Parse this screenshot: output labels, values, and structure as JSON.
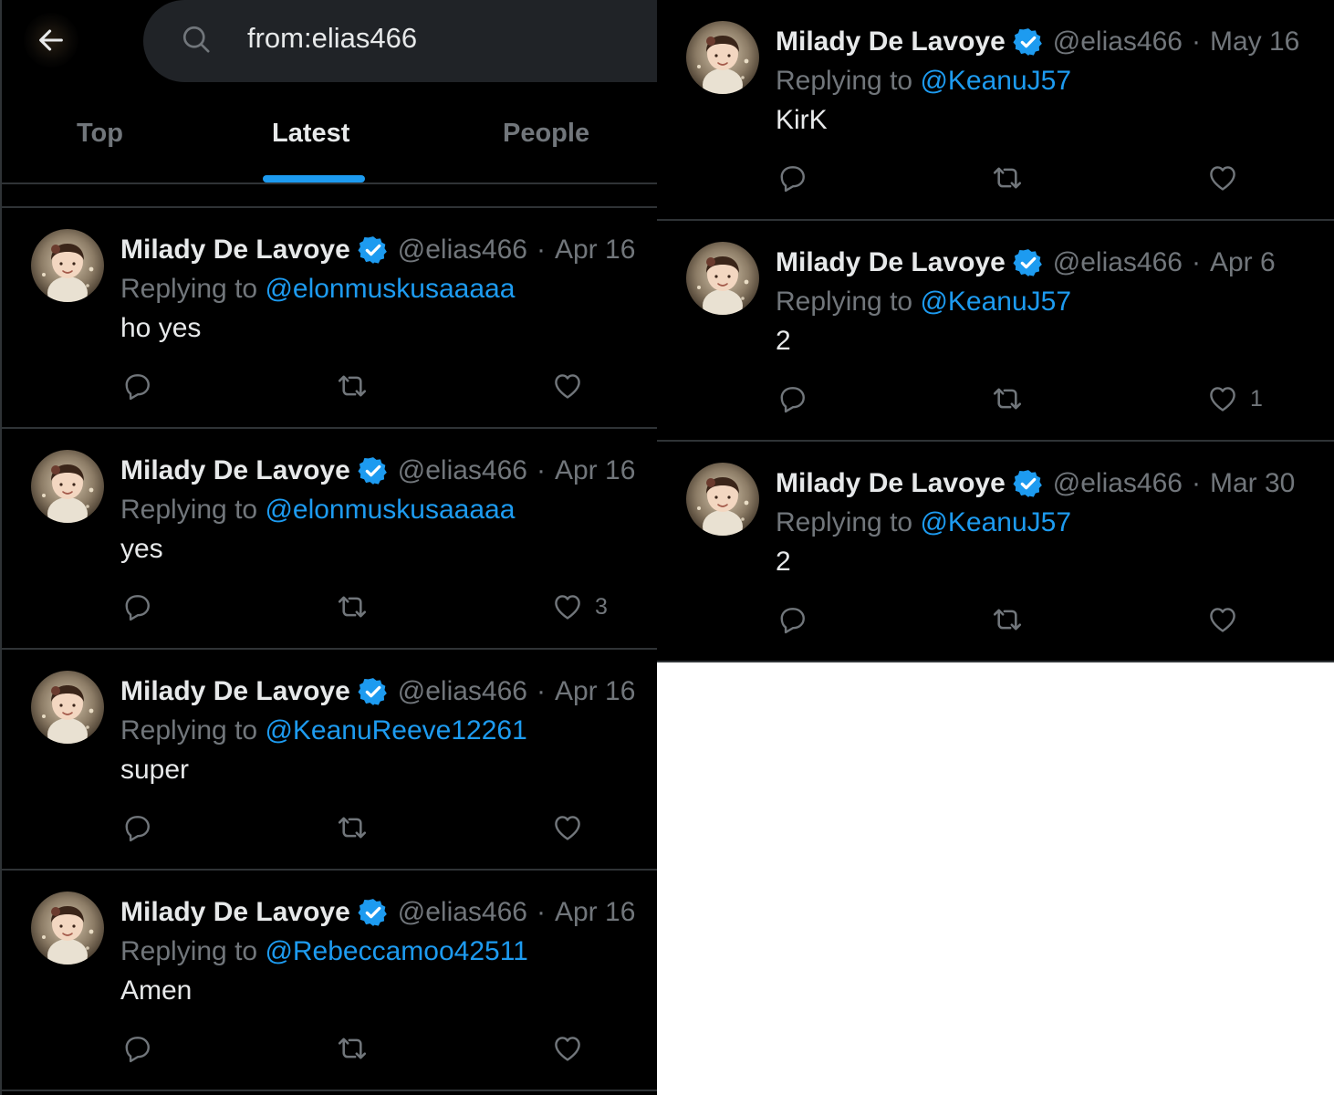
{
  "search": {
    "query": "from:elias466"
  },
  "tabs": [
    {
      "label": "Top",
      "active": false
    },
    {
      "label": "Latest",
      "active": true
    },
    {
      "label": "People",
      "active": false
    }
  ],
  "icons": {
    "back": "back-arrow-icon",
    "search": "search-icon",
    "verified": "verified-badge-icon",
    "reply": "reply-icon",
    "retweet": "retweet-icon",
    "like": "heart-icon"
  },
  "colors": {
    "accent": "#1d9bf0",
    "background": "#000000",
    "muted": "#71767b",
    "text": "#e7e9ea",
    "divider": "#2f3336"
  },
  "left_tweets": [
    {
      "name": "Milady De Lavoye",
      "handle": "@elias466",
      "dot": "·",
      "date": "Apr 16",
      "reply_prefix": "Replying to",
      "reply_to": "@elonmuskusaaaaa",
      "text": "ho yes",
      "likes": ""
    },
    {
      "name": "Milady De Lavoye",
      "handle": "@elias466",
      "dot": "·",
      "date": "Apr 16",
      "reply_prefix": "Replying to",
      "reply_to": "@elonmuskusaaaaa",
      "text": "yes",
      "likes": "3"
    },
    {
      "name": "Milady De Lavoye",
      "handle": "@elias466",
      "dot": "·",
      "date": "Apr 16",
      "reply_prefix": "Replying to",
      "reply_to": "@KeanuReeve12261",
      "text": "super",
      "likes": ""
    },
    {
      "name": "Milady De Lavoye",
      "handle": "@elias466",
      "dot": "·",
      "date": "Apr 16",
      "reply_prefix": "Replying to",
      "reply_to": "@Rebeccamoo42511",
      "text": "Amen",
      "likes": ""
    }
  ],
  "right_tweets": [
    {
      "name": "Milady De Lavoye",
      "handle": "@elias466",
      "dot": "·",
      "date": "May 16",
      "reply_prefix": "Replying to",
      "reply_to": "@KeanuJ57",
      "text": "KirK",
      "likes": ""
    },
    {
      "name": "Milady De Lavoye",
      "handle": "@elias466",
      "dot": "·",
      "date": "Apr 6",
      "reply_prefix": "Replying to",
      "reply_to": "@KeanuJ57",
      "text": "2",
      "likes": "1"
    },
    {
      "name": "Milady De Lavoye",
      "handle": "@elias466",
      "dot": "·",
      "date": "Mar 30",
      "reply_prefix": "Replying to",
      "reply_to": "@KeanuJ57",
      "text": "2",
      "likes": ""
    }
  ]
}
